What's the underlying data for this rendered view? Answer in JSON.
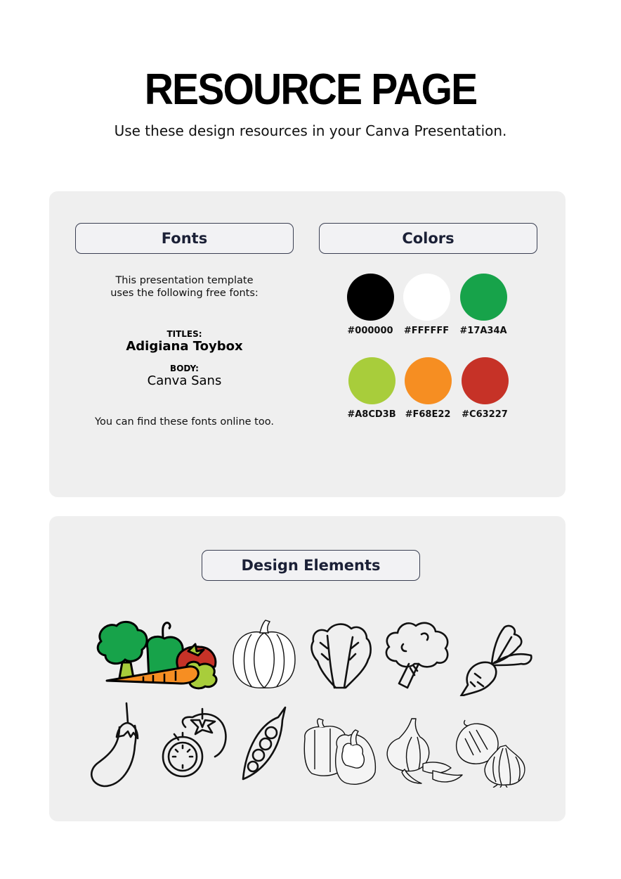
{
  "page": {
    "title": "RESOURCE PAGE",
    "subtitle": "Use these design resources in your Canva Presentation."
  },
  "fonts": {
    "heading": "Fonts",
    "intro_line1": "This presentation template",
    "intro_line2": "uses the following free fonts:",
    "titles_label": "TITLES:",
    "titles_font": "Adigiana Toybox",
    "body_label": "BODY:",
    "body_font": "Canva Sans",
    "outro": "You can find these fonts online too."
  },
  "colors": {
    "heading": "Colors",
    "swatches": [
      {
        "hex": "#000000",
        "label": "#000000"
      },
      {
        "hex": "#FFFFFF",
        "label": "#FFFFFF"
      },
      {
        "hex": "#17A34A",
        "label": "#17A34A"
      },
      {
        "hex": "#A8CD3B",
        "label": "#A8CD3B"
      },
      {
        "hex": "#F68E22",
        "label": "#F68E22"
      },
      {
        "hex": "#C63227",
        "label": "#C63227"
      }
    ]
  },
  "design_elements": {
    "heading": "Design Elements",
    "items": [
      "vegetable-bundle-icon",
      "pumpkin-icon",
      "lettuce-icon",
      "broccoli-icon",
      "beetroot-icon",
      "eggplant-icon",
      "tomato-icon",
      "pea-pod-icon",
      "bell-pepper-icon",
      "garlic-icon",
      "onion-icon"
    ]
  }
}
